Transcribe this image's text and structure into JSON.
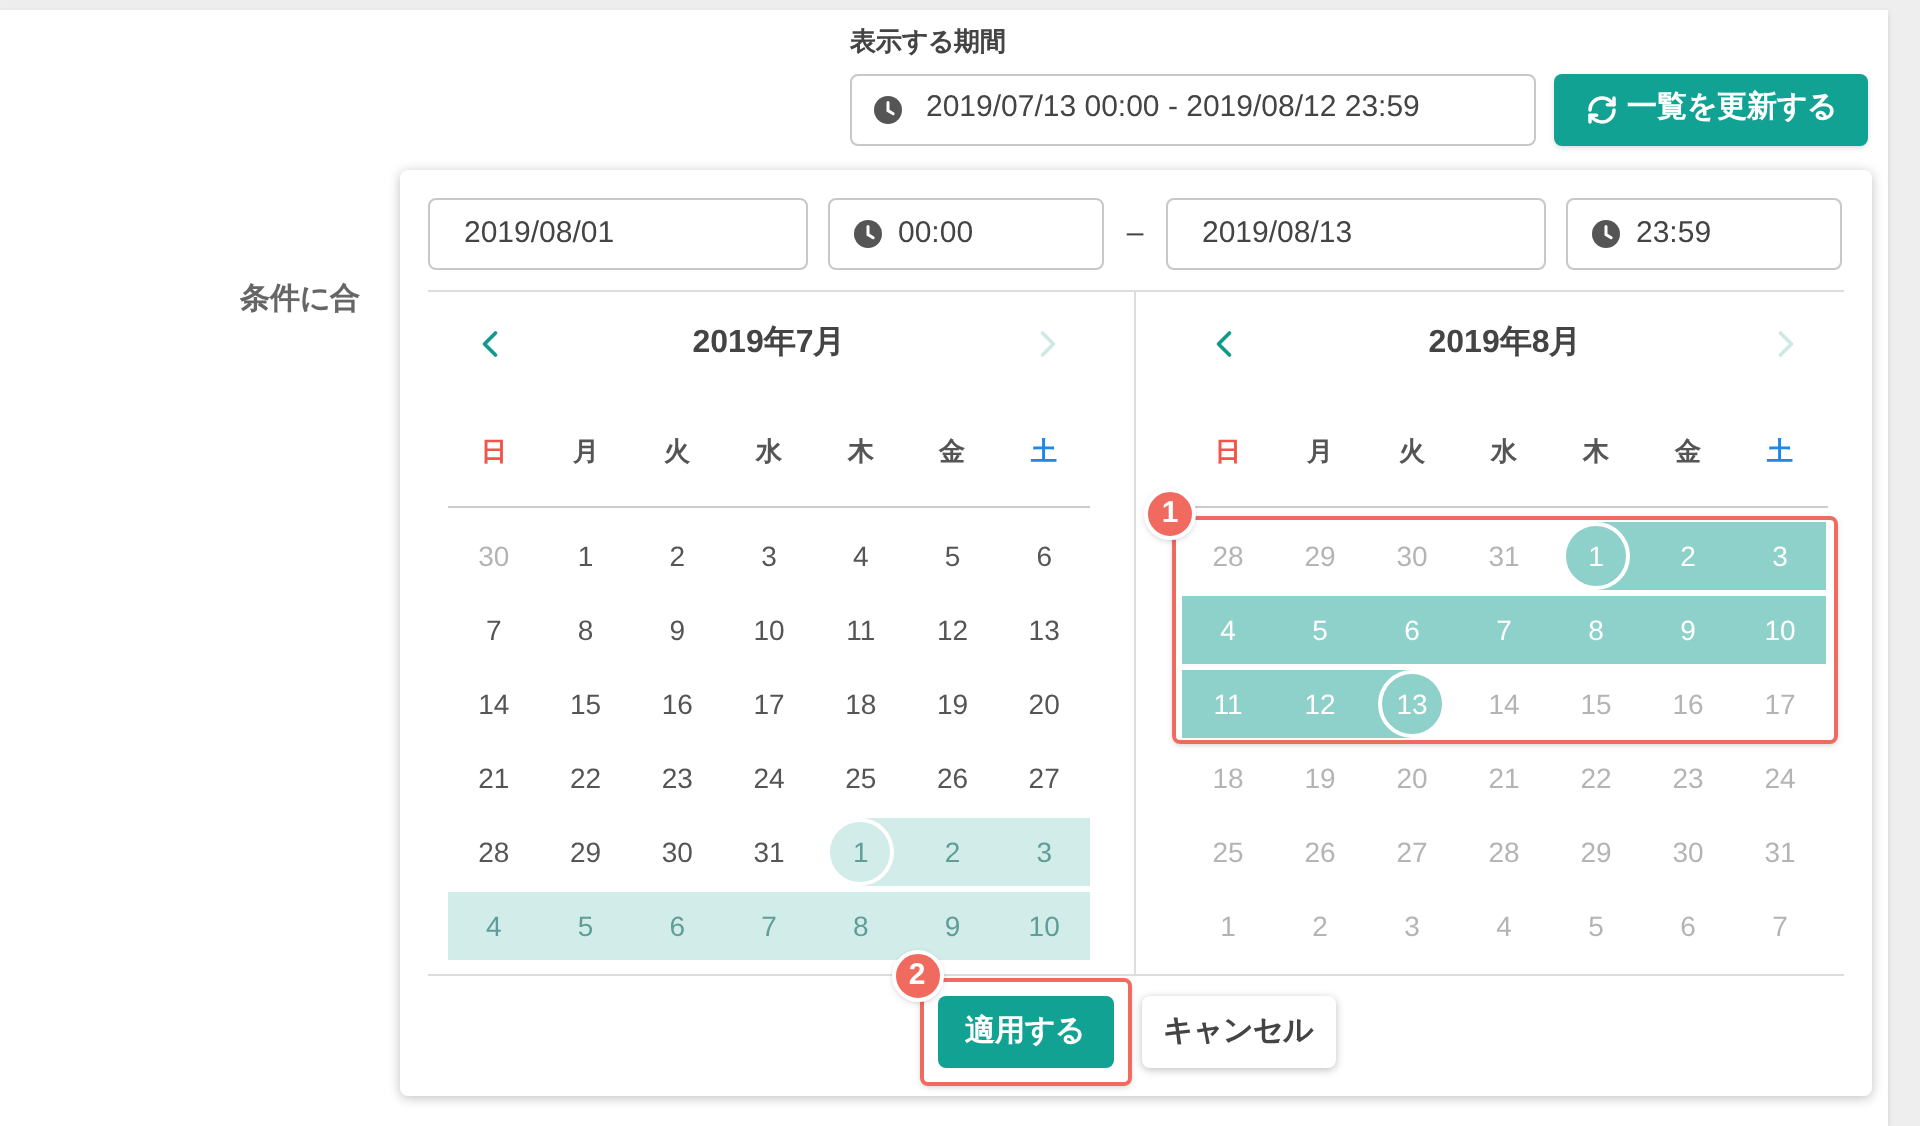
{
  "period": {
    "label": "表示する期間",
    "value": "2019/07/13 00:00 - 2019/08/12 23:59"
  },
  "refresh_button": {
    "label": "一覧を更新する"
  },
  "background_heading": "条件に合",
  "picker": {
    "start_date": "2019/08/01",
    "start_time": "00:00",
    "separator": "–",
    "end_date": "2019/08/13",
    "end_time": "23:59",
    "calendars": [
      {
        "title": "2019年7月",
        "prev": {
          "disabled": false
        },
        "next": {
          "disabled": true
        },
        "weekdays": [
          {
            "label": "日",
            "color": "#f0564c"
          },
          {
            "label": "月",
            "color": "#555555"
          },
          {
            "label": "火",
            "color": "#555555"
          },
          {
            "label": "水",
            "color": "#555555"
          },
          {
            "label": "木",
            "color": "#555555"
          },
          {
            "label": "金",
            "color": "#555555"
          },
          {
            "label": "土",
            "color": "#1e88e5"
          }
        ],
        "weeks": [
          [
            {
              "label": "30",
              "faded": true,
              "in_range": false,
              "range_start": false,
              "range_end": false
            },
            {
              "label": "1",
              "faded": false,
              "in_range": false,
              "range_start": false,
              "range_end": false
            },
            {
              "label": "2",
              "faded": false,
              "in_range": false,
              "range_start": false,
              "range_end": false
            },
            {
              "label": "3",
              "faded": false,
              "in_range": false,
              "range_start": false,
              "range_end": false
            },
            {
              "label": "4",
              "faded": false,
              "in_range": false,
              "range_start": false,
              "range_end": false
            },
            {
              "label": "5",
              "faded": false,
              "in_range": false,
              "range_start": false,
              "range_end": false
            },
            {
              "label": "6",
              "faded": false,
              "in_range": false,
              "range_start": false,
              "range_end": false
            }
          ],
          [
            {
              "label": "7",
              "faded": false,
              "in_range": false,
              "range_start": false,
              "range_end": false
            },
            {
              "label": "8",
              "faded": false,
              "in_range": false,
              "range_start": false,
              "range_end": false
            },
            {
              "label": "9",
              "faded": false,
              "in_range": false,
              "range_start": false,
              "range_end": false
            },
            {
              "label": "10",
              "faded": false,
              "in_range": false,
              "range_start": false,
              "range_end": false
            },
            {
              "label": "11",
              "faded": false,
              "in_range": false,
              "range_start": false,
              "range_end": false
            },
            {
              "label": "12",
              "faded": false,
              "in_range": false,
              "range_start": false,
              "range_end": false
            },
            {
              "label": "13",
              "faded": false,
              "in_range": false,
              "range_start": false,
              "range_end": false
            }
          ],
          [
            {
              "label": "14",
              "faded": false,
              "in_range": false,
              "range_start": false,
              "range_end": false
            },
            {
              "label": "15",
              "faded": false,
              "in_range": false,
              "range_start": false,
              "range_end": false
            },
            {
              "label": "16",
              "faded": false,
              "in_range": false,
              "range_start": false,
              "range_end": false
            },
            {
              "label": "17",
              "faded": false,
              "in_range": false,
              "range_start": false,
              "range_end": false
            },
            {
              "label": "18",
              "faded": false,
              "in_range": false,
              "range_start": false,
              "range_end": false
            },
            {
              "label": "19",
              "faded": false,
              "in_range": false,
              "range_start": false,
              "range_end": false
            },
            {
              "label": "20",
              "faded": false,
              "in_range": false,
              "range_start": false,
              "range_end": false
            }
          ],
          [
            {
              "label": "21",
              "faded": false,
              "in_range": false,
              "range_start": false,
              "range_end": false
            },
            {
              "label": "22",
              "faded": false,
              "in_range": false,
              "range_start": false,
              "range_end": false
            },
            {
              "label": "23",
              "faded": false,
              "in_range": false,
              "range_start": false,
              "range_end": false
            },
            {
              "label": "24",
              "faded": false,
              "in_range": false,
              "range_start": false,
              "range_end": false
            },
            {
              "label": "25",
              "faded": false,
              "in_range": false,
              "range_start": false,
              "range_end": false
            },
            {
              "label": "26",
              "faded": false,
              "in_range": false,
              "range_start": false,
              "range_end": false
            },
            {
              "label": "27",
              "faded": false,
              "in_range": false,
              "range_start": false,
              "range_end": false
            }
          ],
          [
            {
              "label": "28",
              "faded": false,
              "in_range": false,
              "range_start": false,
              "range_end": false
            },
            {
              "label": "29",
              "faded": false,
              "in_range": false,
              "range_start": false,
              "range_end": false
            },
            {
              "label": "30",
              "faded": false,
              "in_range": false,
              "range_start": false,
              "range_end": false
            },
            {
              "label": "31",
              "faded": false,
              "in_range": false,
              "range_start": false,
              "range_end": false
            },
            {
              "label": "1",
              "faded": true,
              "in_range": true,
              "range_start": true,
              "range_end": false
            },
            {
              "label": "2",
              "faded": true,
              "in_range": true,
              "range_start": false,
              "range_end": false
            },
            {
              "label": "3",
              "faded": true,
              "in_range": true,
              "range_start": false,
              "range_end": false
            }
          ],
          [
            {
              "label": "4",
              "faded": true,
              "in_range": true,
              "range_start": false,
              "range_end": false
            },
            {
              "label": "5",
              "faded": true,
              "in_range": true,
              "range_start": false,
              "range_end": false
            },
            {
              "label": "6",
              "faded": true,
              "in_range": true,
              "range_start": false,
              "range_end": false
            },
            {
              "label": "7",
              "faded": true,
              "in_range": true,
              "range_start": false,
              "range_end": false
            },
            {
              "label": "8",
              "faded": true,
              "in_range": true,
              "range_start": false,
              "range_end": false
            },
            {
              "label": "9",
              "faded": true,
              "in_range": true,
              "range_start": false,
              "range_end": false
            },
            {
              "label": "10",
              "faded": true,
              "in_range": true,
              "range_start": false,
              "range_end": false
            }
          ]
        ]
      },
      {
        "title": "2019年8月",
        "prev": {
          "disabled": false
        },
        "next": {
          "disabled": true
        },
        "callout": "1",
        "weekdays": [
          {
            "label": "日",
            "color": "#f0564c"
          },
          {
            "label": "月",
            "color": "#555555"
          },
          {
            "label": "火",
            "color": "#555555"
          },
          {
            "label": "水",
            "color": "#555555"
          },
          {
            "label": "木",
            "color": "#555555"
          },
          {
            "label": "金",
            "color": "#555555"
          },
          {
            "label": "土",
            "color": "#1e88e5"
          }
        ],
        "weeks": [
          [
            {
              "label": "28",
              "faded": true,
              "in_range": false,
              "range_start": false,
              "range_end": false
            },
            {
              "label": "29",
              "faded": true,
              "in_range": false,
              "range_start": false,
              "range_end": false
            },
            {
              "label": "30",
              "faded": true,
              "in_range": false,
              "range_start": false,
              "range_end": false
            },
            {
              "label": "31",
              "faded": true,
              "in_range": false,
              "range_start": false,
              "range_end": false
            },
            {
              "label": "1",
              "faded": false,
              "in_range": true,
              "range_start": true,
              "range_end": false
            },
            {
              "label": "2",
              "faded": false,
              "in_range": true,
              "range_start": false,
              "range_end": false
            },
            {
              "label": "3",
              "faded": false,
              "in_range": true,
              "range_start": false,
              "range_end": false
            }
          ],
          [
            {
              "label": "4",
              "faded": false,
              "in_range": true,
              "range_start": false,
              "range_end": false
            },
            {
              "label": "5",
              "faded": false,
              "in_range": true,
              "range_start": false,
              "range_end": false
            },
            {
              "label": "6",
              "faded": false,
              "in_range": true,
              "range_start": false,
              "range_end": false
            },
            {
              "label": "7",
              "faded": false,
              "in_range": true,
              "range_start": false,
              "range_end": false
            },
            {
              "label": "8",
              "faded": false,
              "in_range": true,
              "range_start": false,
              "range_end": false
            },
            {
              "label": "9",
              "faded": false,
              "in_range": true,
              "range_start": false,
              "range_end": false
            },
            {
              "label": "10",
              "faded": false,
              "in_range": true,
              "range_start": false,
              "range_end": false
            }
          ],
          [
            {
              "label": "11",
              "faded": false,
              "in_range": true,
              "range_start": false,
              "range_end": false
            },
            {
              "label": "12",
              "faded": false,
              "in_range": true,
              "range_start": false,
              "range_end": false
            },
            {
              "label": "13",
              "faded": false,
              "in_range": true,
              "range_start": false,
              "range_end": true
            },
            {
              "label": "14",
              "faded": true,
              "in_range": false,
              "range_start": false,
              "range_end": false
            },
            {
              "label": "15",
              "faded": true,
              "in_range": false,
              "range_start": false,
              "range_end": false
            },
            {
              "label": "16",
              "faded": true,
              "in_range": false,
              "range_start": false,
              "range_end": false
            },
            {
              "label": "17",
              "faded": true,
              "in_range": false,
              "range_start": false,
              "range_end": false
            }
          ],
          [
            {
              "label": "18",
              "faded": true,
              "in_range": false,
              "range_start": false,
              "range_end": false
            },
            {
              "label": "19",
              "faded": true,
              "in_range": false,
              "range_start": false,
              "range_end": false
            },
            {
              "label": "20",
              "faded": true,
              "in_range": false,
              "range_start": false,
              "range_end": false
            },
            {
              "label": "21",
              "faded": true,
              "in_range": false,
              "range_start": false,
              "range_end": false
            },
            {
              "label": "22",
              "faded": true,
              "in_range": false,
              "range_start": false,
              "range_end": false
            },
            {
              "label": "23",
              "faded": true,
              "in_range": false,
              "range_start": false,
              "range_end": false
            },
            {
              "label": "24",
              "faded": true,
              "in_range": false,
              "range_start": false,
              "range_end": false
            }
          ],
          [
            {
              "label": "25",
              "faded": true,
              "in_range": false,
              "range_start": false,
              "range_end": false
            },
            {
              "label": "26",
              "faded": true,
              "in_range": false,
              "range_start": false,
              "range_end": false
            },
            {
              "label": "27",
              "faded": true,
              "in_range": false,
              "range_start": false,
              "range_end": false
            },
            {
              "label": "28",
              "faded": true,
              "in_range": false,
              "range_start": false,
              "range_end": false
            },
            {
              "label": "29",
              "faded": true,
              "in_range": false,
              "range_start": false,
              "range_end": false
            },
            {
              "label": "30",
              "faded": true,
              "in_range": false,
              "range_start": false,
              "range_end": false
            },
            {
              "label": "31",
              "faded": true,
              "in_range": false,
              "range_start": false,
              "range_end": false
            }
          ],
          [
            {
              "label": "1",
              "faded": true,
              "in_range": false,
              "range_start": false,
              "range_end": false
            },
            {
              "label": "2",
              "faded": true,
              "in_range": false,
              "range_start": false,
              "range_end": false
            },
            {
              "label": "3",
              "faded": true,
              "in_range": false,
              "range_start": false,
              "range_end": false
            },
            {
              "label": "4",
              "faded": true,
              "in_range": false,
              "range_start": false,
              "range_end": false
            },
            {
              "label": "5",
              "faded": true,
              "in_range": false,
              "range_start": false,
              "range_end": false
            },
            {
              "label": "6",
              "faded": true,
              "in_range": false,
              "range_start": false,
              "range_end": false
            },
            {
              "label": "7",
              "faded": true,
              "in_range": false,
              "range_start": false,
              "range_end": false
            }
          ]
        ]
      }
    ],
    "apply_button": {
      "label": "適用する",
      "callout": "2"
    },
    "cancel_button": {
      "label": "キャンセル"
    }
  }
}
